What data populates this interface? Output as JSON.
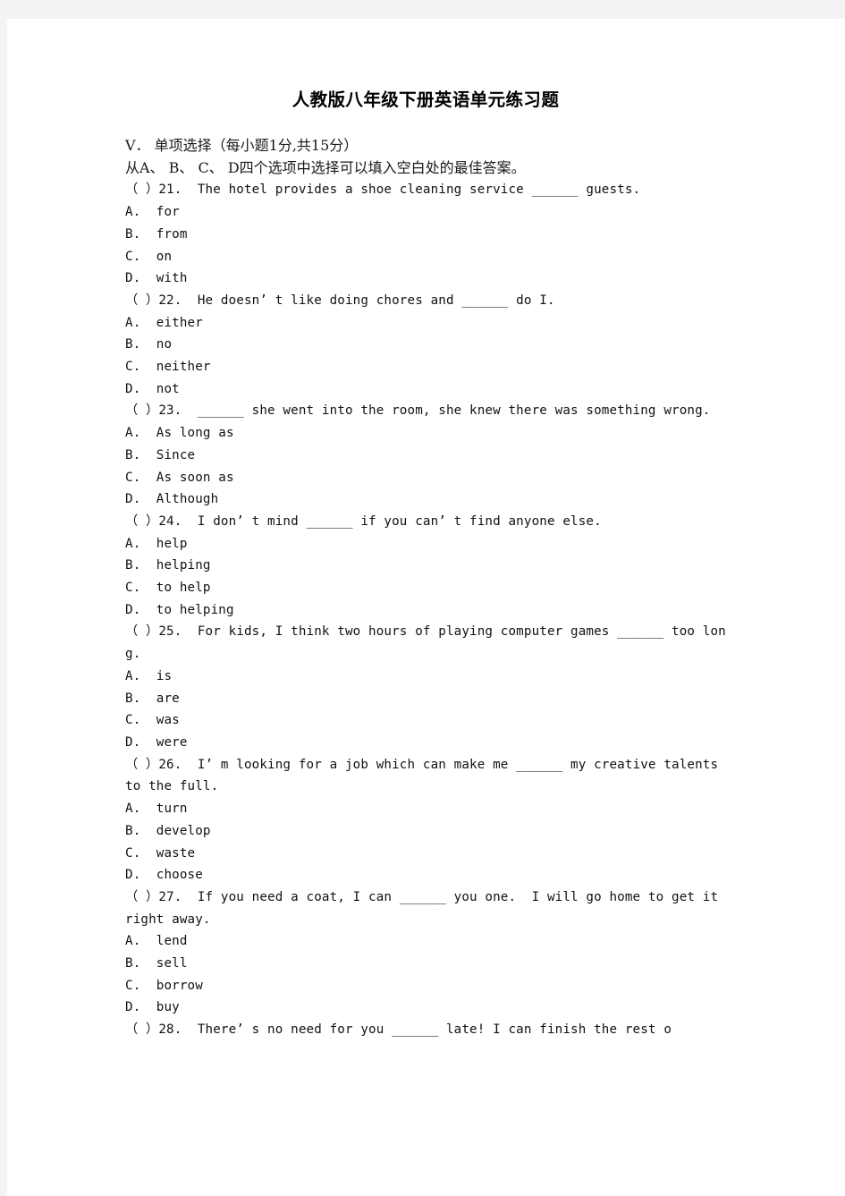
{
  "document": {
    "title": "人教版八年级下册英语单元练习题",
    "section_heading": "Ⅴ． 单项选择（每小题1分,共15分）",
    "instruction": "从A、 B、 C、 D四个选项中选择可以填入空白处的最佳答案。"
  },
  "questions": [
    {
      "stem": "（ ）21.  The hotel provides a shoe cleaning service ______ guests.",
      "options": [
        "A.  for",
        "B.  from",
        "C.  on",
        "D.  with"
      ]
    },
    {
      "stem": "（ ）22.  He doesn’ t like doing chores and ______ do I.",
      "options": [
        "A.  either",
        "B.  no",
        "C.  neither",
        "D.  not"
      ]
    },
    {
      "stem": "（ ）23.  ______ she went into the room, she knew there was something wrong.",
      "options": [
        "A.  As long as",
        "B.  Since",
        "C.  As soon as",
        "D.  Although"
      ]
    },
    {
      "stem": "（ ）24.  I don’ t mind ______ if you can’ t find anyone else.",
      "options": [
        "A.  help",
        "B.  helping",
        "C.  to help",
        "D.  to helping"
      ]
    },
    {
      "stem": "（ ）25.  For kids, I think two hours of playing computer games ______ too long.",
      "options": [
        "A.  is",
        "B.  are",
        "C.  was",
        "D.  were"
      ]
    },
    {
      "stem": "（ ）26.  I’ m looking for a job which can make me ______ my creative talents to the full.",
      "options": [
        "A.  turn",
        "B.  develop",
        "C.  waste",
        "D.  choose"
      ]
    },
    {
      "stem": "（ ）27.  If you need a coat, I can ______ you one.  I will go home to get it right away.",
      "options": [
        "A.  lend",
        "B.  sell",
        "C.  borrow",
        "D.  buy"
      ]
    },
    {
      "stem": "（ ）28.  There’ s no need for you ______ late! I can finish the rest o",
      "options": []
    }
  ],
  "colors": {
    "page_background": "#ffffff",
    "border_background": "#f3f3f3",
    "text": "#111111"
  }
}
